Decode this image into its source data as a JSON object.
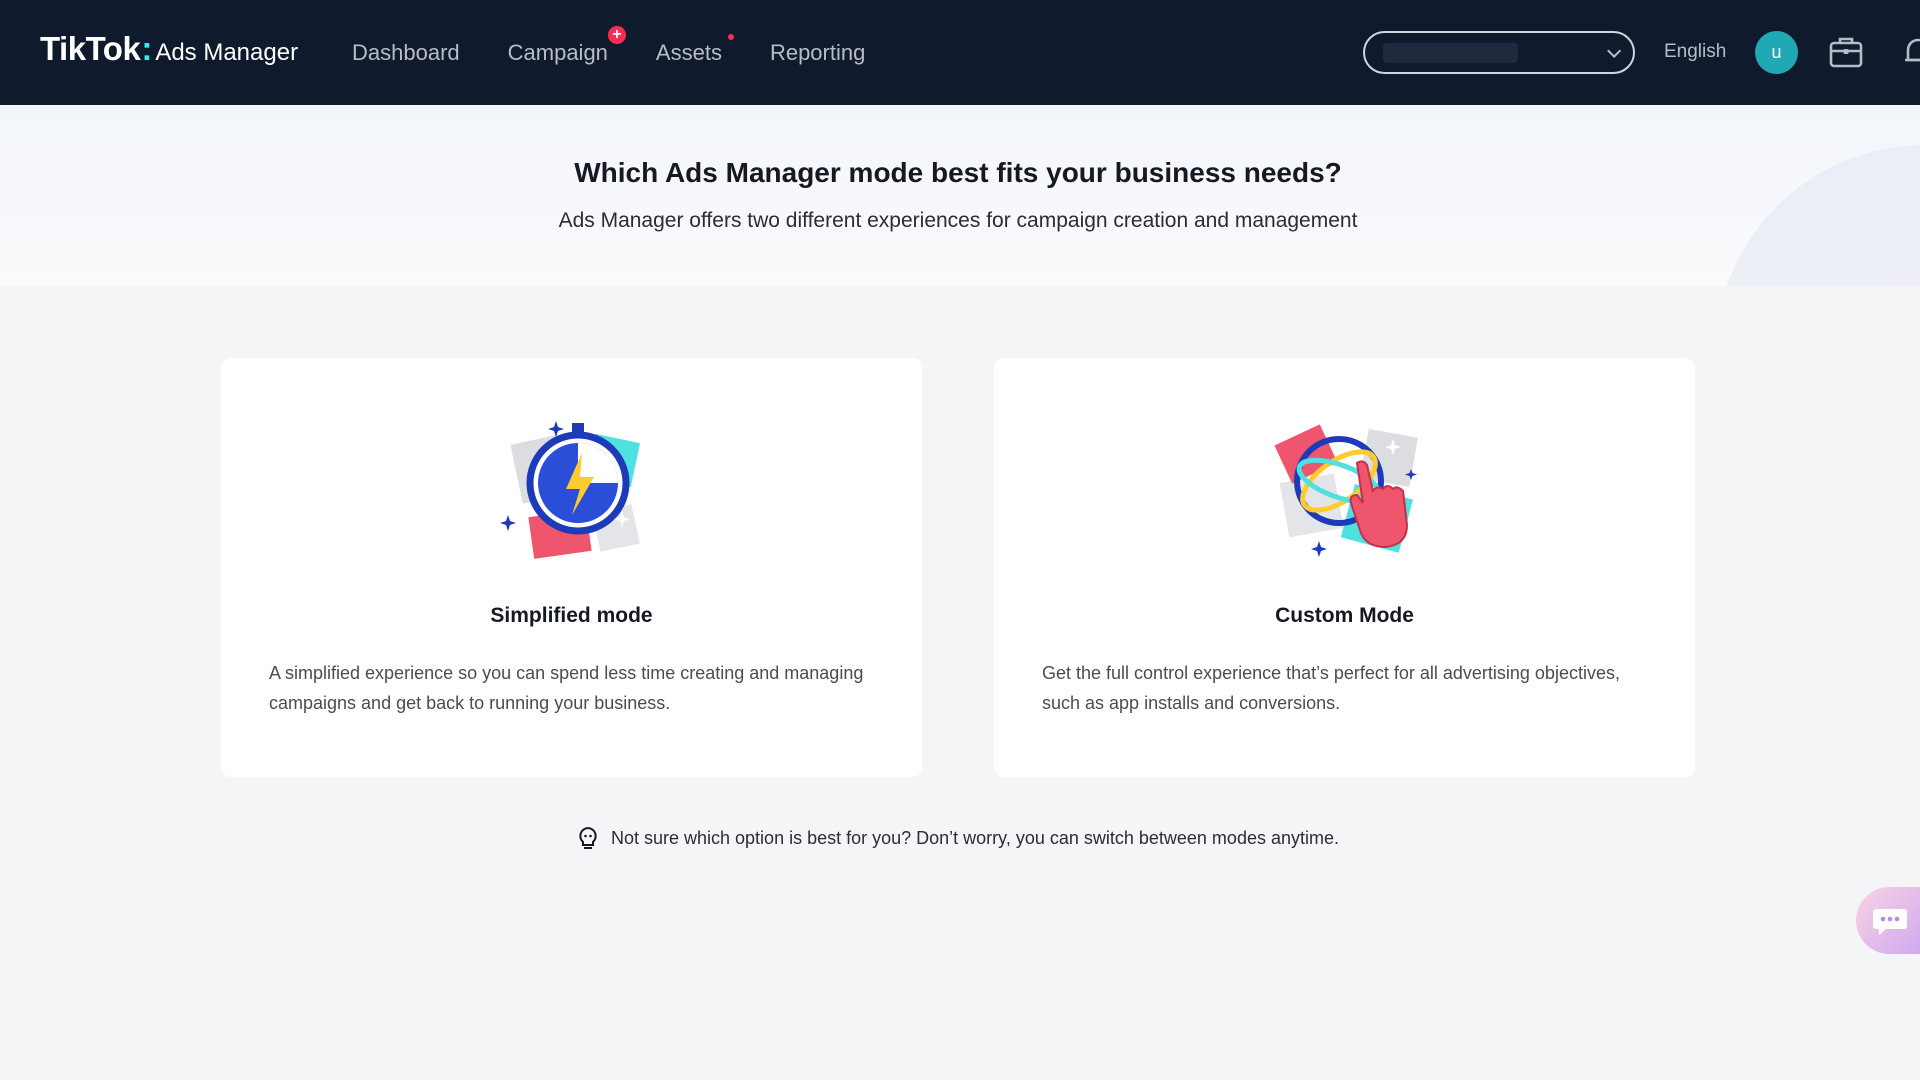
{
  "brand": {
    "name": "TikTok",
    "sub": "Ads Manager"
  },
  "nav": {
    "items": [
      {
        "label": "Dashboard"
      },
      {
        "label": "Campaign",
        "badge": "+"
      },
      {
        "label": "Assets",
        "dot": true
      },
      {
        "label": "Reporting"
      }
    ]
  },
  "header": {
    "language": "English",
    "avatar_initial": "u"
  },
  "hero": {
    "title": "Which Ads Manager mode best fits your business needs?",
    "subtitle": "Ads Manager offers two different experiences for campaign creation and management"
  },
  "modes": [
    {
      "title": "Simplified mode",
      "description": "A simplified experience so you can spend less time creating and managing campaigns and get back to running your business.",
      "icon": "stopwatch-lightning-icon"
    },
    {
      "title": "Custom Mode",
      "description": "Get the full control experience that’s perfect for all advertising objectives, such as app installs and conversions.",
      "icon": "hand-globe-icon"
    }
  ],
  "tip": {
    "text": "Not sure which option is best for you? Don’t worry, you can switch between modes anytime.",
    "icon": "lightbulb-icon"
  },
  "colors": {
    "nav_bg": "#0f1a2d",
    "accent_red": "#fe2c55",
    "accent_cyan": "#25f4ee",
    "avatar_bg": "#20a9b4",
    "page_bg": "#f4f5f7"
  }
}
